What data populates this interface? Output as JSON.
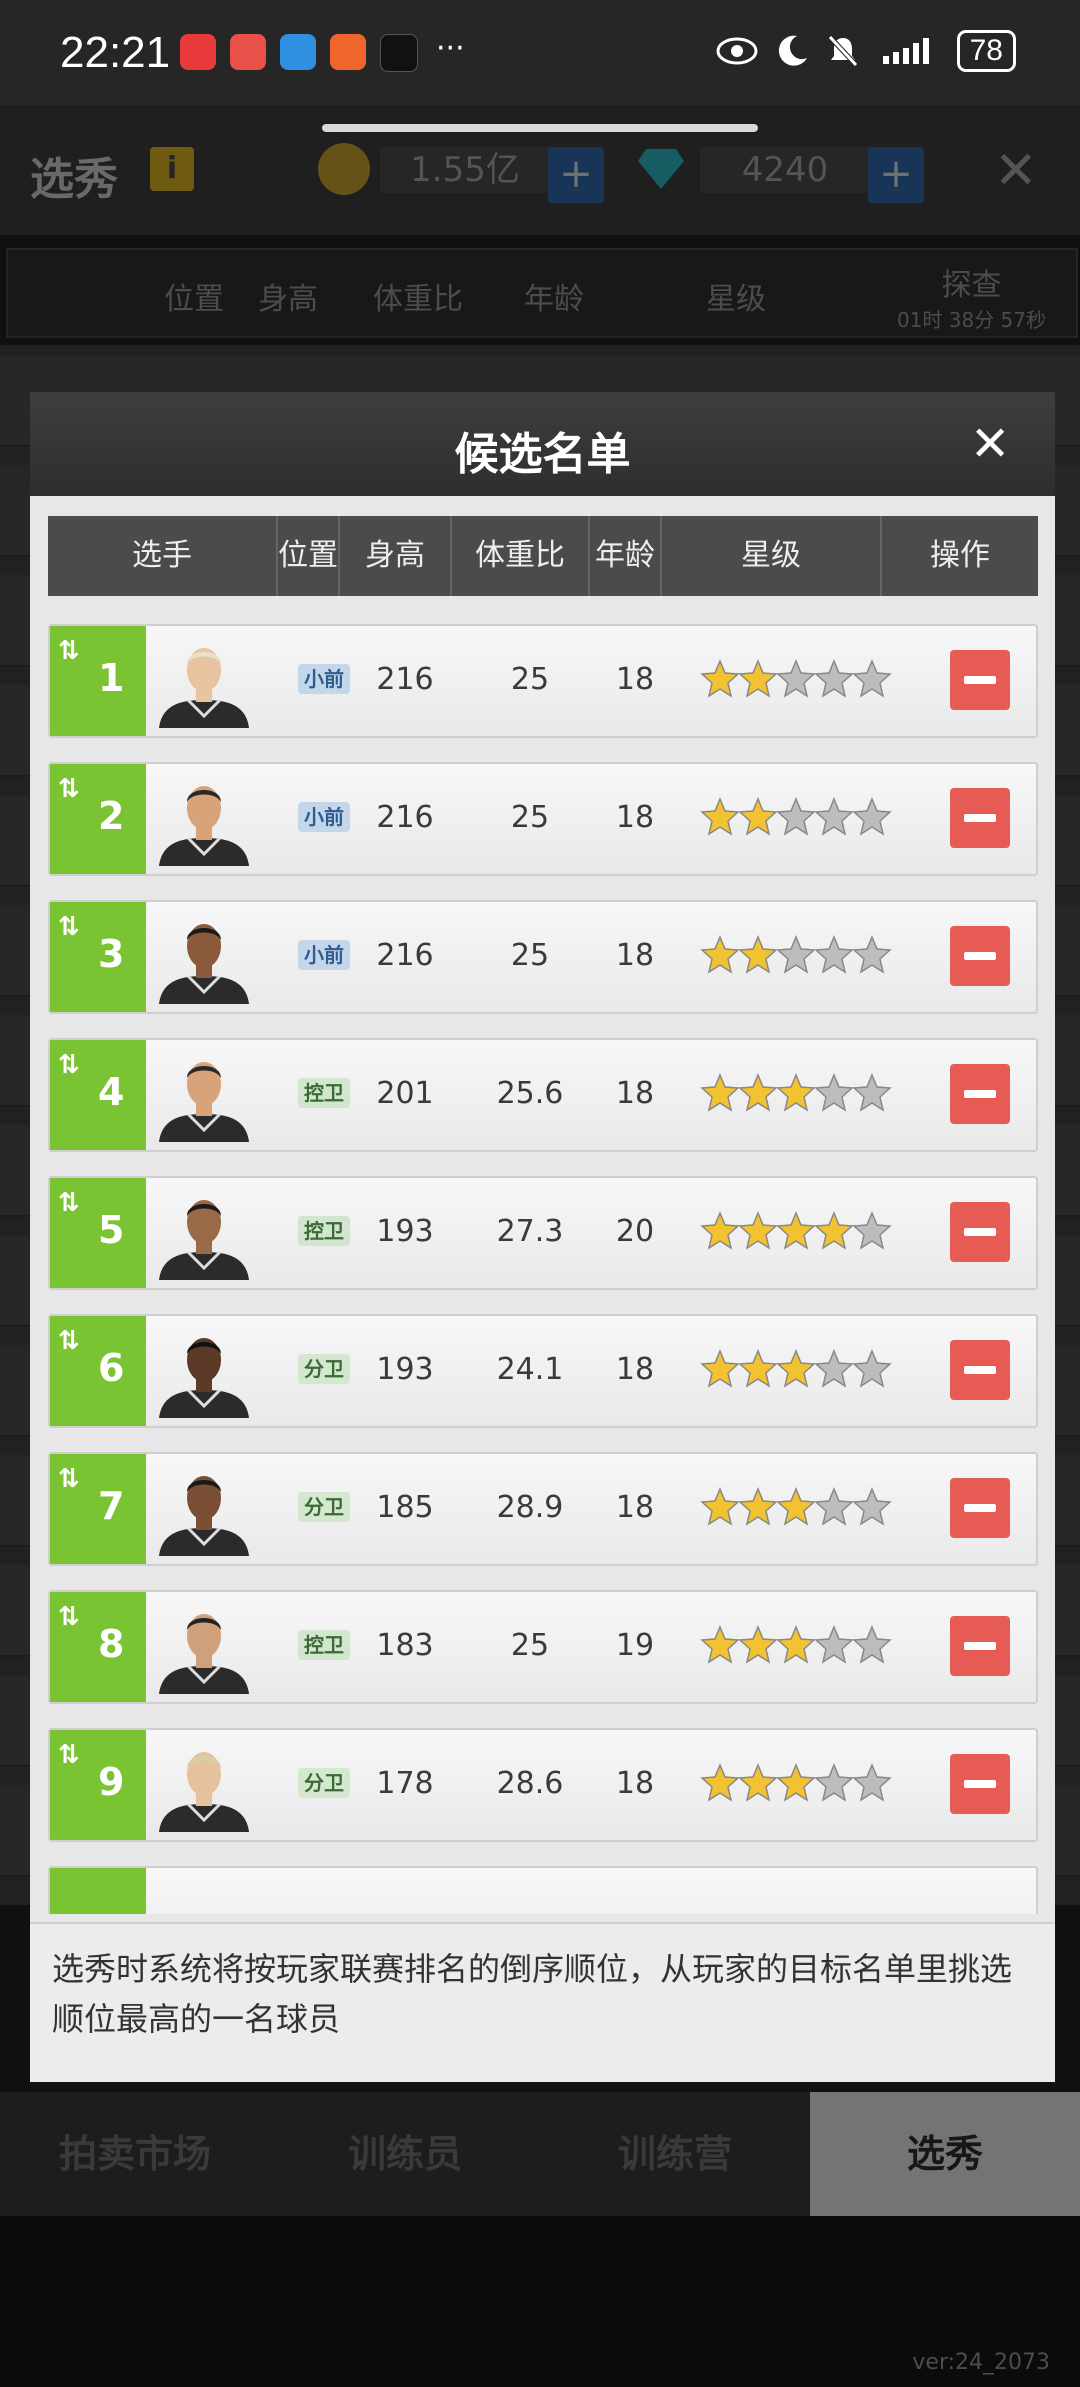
{
  "status_bar": {
    "time": "22:21",
    "battery": "78",
    "app_icons": [
      "xiaohongshu-icon",
      "shop-icon",
      "browser-icon",
      "feishu-icon",
      "capcut-icon"
    ],
    "more": "···"
  },
  "topbar": {
    "title": "选秀",
    "info": "i",
    "coins": "1.55亿",
    "gems": "4240",
    "plus": "+",
    "close": "✕"
  },
  "bg_table": {
    "headers": [
      "位置",
      "身高",
      "体重比",
      "年龄",
      "星级"
    ],
    "scout_label": "探查",
    "scout_timer": "01时 38分 57秒"
  },
  "modal": {
    "title": "候选名单",
    "close": "✕",
    "headers": [
      "选手",
      "位置",
      "身高",
      "体重比",
      "年龄",
      "星级",
      "操作"
    ],
    "players": [
      {
        "rank": "1",
        "position": "小前",
        "pos_type": "sf",
        "height": "216",
        "weight_ratio": "25",
        "age": "18",
        "stars": 2
      },
      {
        "rank": "2",
        "position": "小前",
        "pos_type": "sf",
        "height": "216",
        "weight_ratio": "25",
        "age": "18",
        "stars": 2
      },
      {
        "rank": "3",
        "position": "小前",
        "pos_type": "sf",
        "height": "216",
        "weight_ratio": "25",
        "age": "18",
        "stars": 2
      },
      {
        "rank": "4",
        "position": "控卫",
        "pos_type": "pg",
        "height": "201",
        "weight_ratio": "25.6",
        "age": "18",
        "stars": 3
      },
      {
        "rank": "5",
        "position": "控卫",
        "pos_type": "pg",
        "height": "193",
        "weight_ratio": "27.3",
        "age": "20",
        "stars": 4
      },
      {
        "rank": "6",
        "position": "分卫",
        "pos_type": "sg",
        "height": "193",
        "weight_ratio": "24.1",
        "age": "18",
        "stars": 3
      },
      {
        "rank": "7",
        "position": "分卫",
        "pos_type": "sg",
        "height": "185",
        "weight_ratio": "28.9",
        "age": "18",
        "stars": 3
      },
      {
        "rank": "8",
        "position": "控卫",
        "pos_type": "pg",
        "height": "183",
        "weight_ratio": "25",
        "age": "19",
        "stars": 3
      },
      {
        "rank": "9",
        "position": "分卫",
        "pos_type": "sg",
        "height": "178",
        "weight_ratio": "28.6",
        "age": "18",
        "stars": 3
      }
    ],
    "note": "选秀时系统将按玩家联赛排名的倒序顺位，从玩家的目标名单里挑选顺位最高的一名球员"
  },
  "bottom_tabs": [
    "拍卖市场",
    "训练员",
    "训练营",
    "选秀"
  ],
  "version": "ver:24_2073",
  "colors": {
    "rank_green": "#7ac332",
    "remove_red": "#e65c55",
    "star_gold": "#f2c230",
    "star_gray": "#bdbdbd"
  }
}
